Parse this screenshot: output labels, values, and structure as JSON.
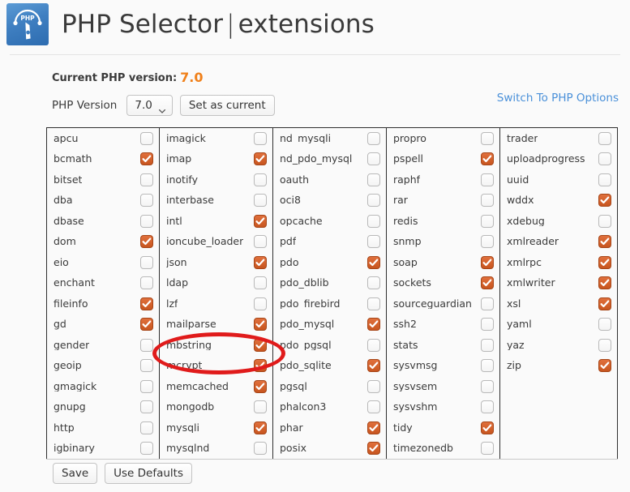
{
  "header": {
    "logo_icon": "php-gauge-logo-icon",
    "title_main": "PHP Selector",
    "title_separator": "|",
    "title_section": "extensions"
  },
  "version": {
    "current_label": "Current PHP version:",
    "current_value": "7.0",
    "select_label": "PHP Version",
    "selected_version": "7.0",
    "version_options": [
      "7.0"
    ],
    "set_current_label": "Set as current",
    "switch_link_label": "Switch To PHP Options"
  },
  "footer": {
    "save_label": "Save",
    "defaults_label": "Use Defaults"
  },
  "annotation": {
    "type": "ellipse-highlight",
    "color": "#e01b1b",
    "target": "mbstring"
  },
  "colors": {
    "accent_orange": "#f0801a",
    "checkbox_on": "#c8551f",
    "link_blue": "#4a90d9",
    "annotation_red": "#e01b1b",
    "page_bg": "#fafafa"
  },
  "extensions": {
    "columns": [
      [
        {
          "name": "apcu",
          "checked": false
        },
        {
          "name": "bcmath",
          "checked": true
        },
        {
          "name": "bitset",
          "checked": false
        },
        {
          "name": "dba",
          "checked": false
        },
        {
          "name": "dbase",
          "checked": false
        },
        {
          "name": "dom",
          "checked": true
        },
        {
          "name": "eio",
          "checked": false
        },
        {
          "name": "enchant",
          "checked": false
        },
        {
          "name": "fileinfo",
          "checked": true
        },
        {
          "name": "gd",
          "checked": true
        },
        {
          "name": "gender",
          "checked": false
        },
        {
          "name": "geoip",
          "checked": false
        },
        {
          "name": "gmagick",
          "checked": false
        },
        {
          "name": "gnupg",
          "checked": false
        },
        {
          "name": "http",
          "checked": false
        },
        {
          "name": "igbinary",
          "checked": false
        }
      ],
      [
        {
          "name": "imagick",
          "checked": false
        },
        {
          "name": "imap",
          "checked": true
        },
        {
          "name": "inotify",
          "checked": false
        },
        {
          "name": "interbase",
          "checked": false
        },
        {
          "name": "intl",
          "checked": true
        },
        {
          "name": "ioncube_loader",
          "checked": false
        },
        {
          "name": "json",
          "checked": true
        },
        {
          "name": "ldap",
          "checked": false
        },
        {
          "name": "lzf",
          "checked": false
        },
        {
          "name": "mailparse",
          "checked": true
        },
        {
          "name": "mbstring",
          "checked": true
        },
        {
          "name": "mcrypt",
          "checked": true
        },
        {
          "name": "memcached",
          "checked": true
        },
        {
          "name": "mongodb",
          "checked": false
        },
        {
          "name": "mysqli",
          "checked": true
        },
        {
          "name": "mysqlnd",
          "checked": false
        }
      ],
      [
        {
          "name": "nd_mysqli",
          "checked": false
        },
        {
          "name": "nd_pdo_mysql",
          "checked": false
        },
        {
          "name": "oauth",
          "checked": false
        },
        {
          "name": "oci8",
          "checked": false
        },
        {
          "name": "opcache",
          "checked": false
        },
        {
          "name": "pdf",
          "checked": false
        },
        {
          "name": "pdo",
          "checked": true
        },
        {
          "name": "pdo_dblib",
          "checked": false
        },
        {
          "name": "pdo_firebird",
          "checked": false
        },
        {
          "name": "pdo_mysql",
          "checked": true
        },
        {
          "name": "pdo_pgsql",
          "checked": false
        },
        {
          "name": "pdo_sqlite",
          "checked": true
        },
        {
          "name": "pgsql",
          "checked": false
        },
        {
          "name": "phalcon3",
          "checked": false
        },
        {
          "name": "phar",
          "checked": true
        },
        {
          "name": "posix",
          "checked": true
        }
      ],
      [
        {
          "name": "propro",
          "checked": false
        },
        {
          "name": "pspell",
          "checked": true
        },
        {
          "name": "raphf",
          "checked": false
        },
        {
          "name": "rar",
          "checked": false
        },
        {
          "name": "redis",
          "checked": false
        },
        {
          "name": "snmp",
          "checked": false
        },
        {
          "name": "soap",
          "checked": true
        },
        {
          "name": "sockets",
          "checked": true
        },
        {
          "name": "sourceguardian",
          "checked": false
        },
        {
          "name": "ssh2",
          "checked": false
        },
        {
          "name": "stats",
          "checked": false
        },
        {
          "name": "sysvmsg",
          "checked": false
        },
        {
          "name": "sysvsem",
          "checked": false
        },
        {
          "name": "sysvshm",
          "checked": false
        },
        {
          "name": "tidy",
          "checked": true
        },
        {
          "name": "timezonedb",
          "checked": false
        }
      ],
      [
        {
          "name": "trader",
          "checked": false
        },
        {
          "name": "uploadprogress",
          "checked": false
        },
        {
          "name": "uuid",
          "checked": false
        },
        {
          "name": "wddx",
          "checked": true
        },
        {
          "name": "xdebug",
          "checked": false
        },
        {
          "name": "xmlreader",
          "checked": true
        },
        {
          "name": "xmlrpc",
          "checked": true
        },
        {
          "name": "xmlwriter",
          "checked": true
        },
        {
          "name": "xsl",
          "checked": true
        },
        {
          "name": "yaml",
          "checked": false
        },
        {
          "name": "yaz",
          "checked": false
        },
        {
          "name": "zip",
          "checked": true
        }
      ]
    ]
  }
}
